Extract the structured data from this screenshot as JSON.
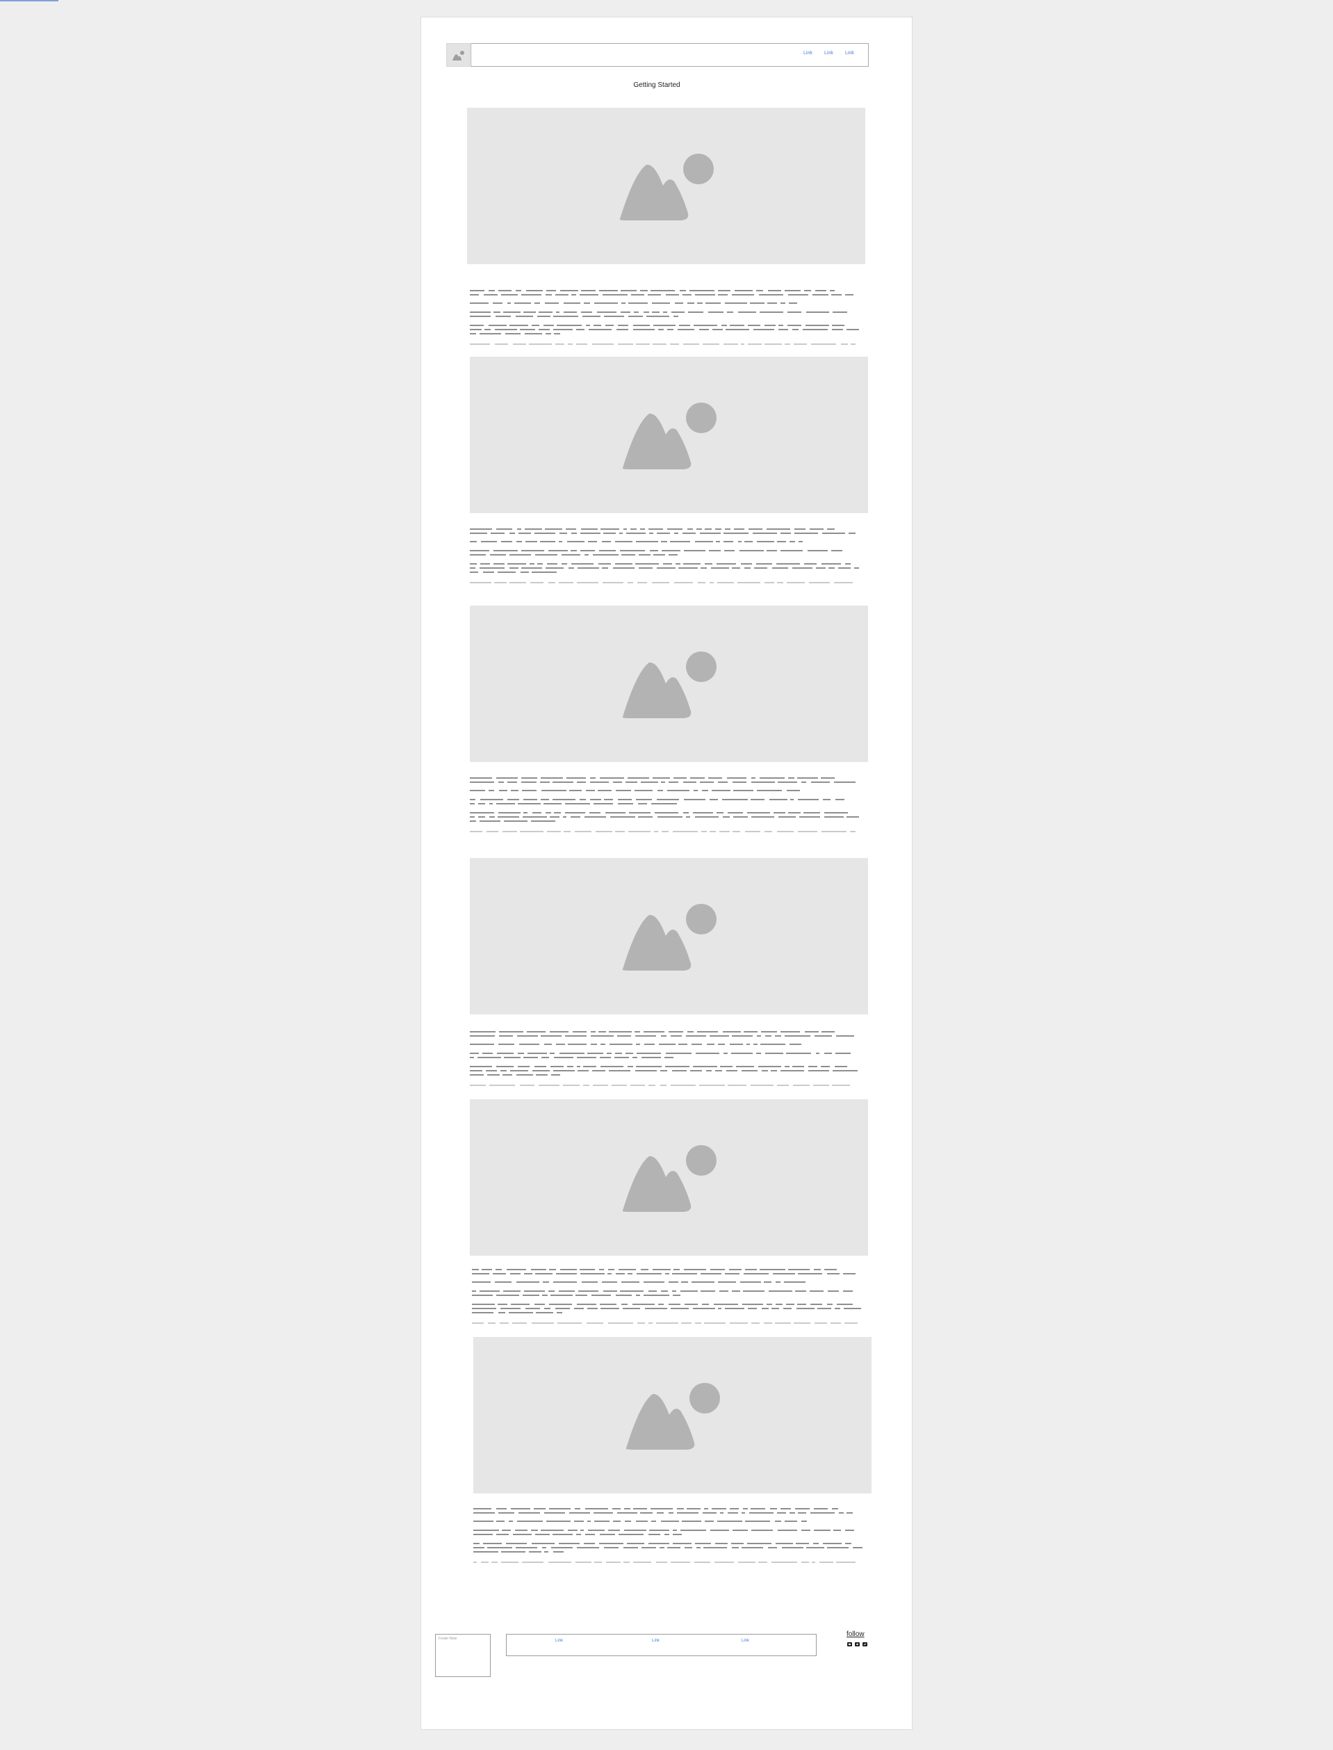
{
  "header": {
    "nav_links": [
      "Link",
      "Link",
      "Link"
    ]
  },
  "page": {
    "title": "Getting Started"
  },
  "content": {
    "image_icon": "image-placeholder-icon",
    "sections": 6
  },
  "footer": {
    "note_label": "Footer Note",
    "links": [
      "Link",
      "Link",
      "Link"
    ],
    "follow_label": "follow",
    "social_icons": [
      "social-icon-1",
      "social-icon-2",
      "social-icon-3"
    ]
  },
  "colors": {
    "background": "#eeeeee",
    "page": "#ffffff",
    "placeholder": "#e6e6e6",
    "placeholder_icon": "#b3b3b3",
    "link": "#4a7dd1"
  }
}
